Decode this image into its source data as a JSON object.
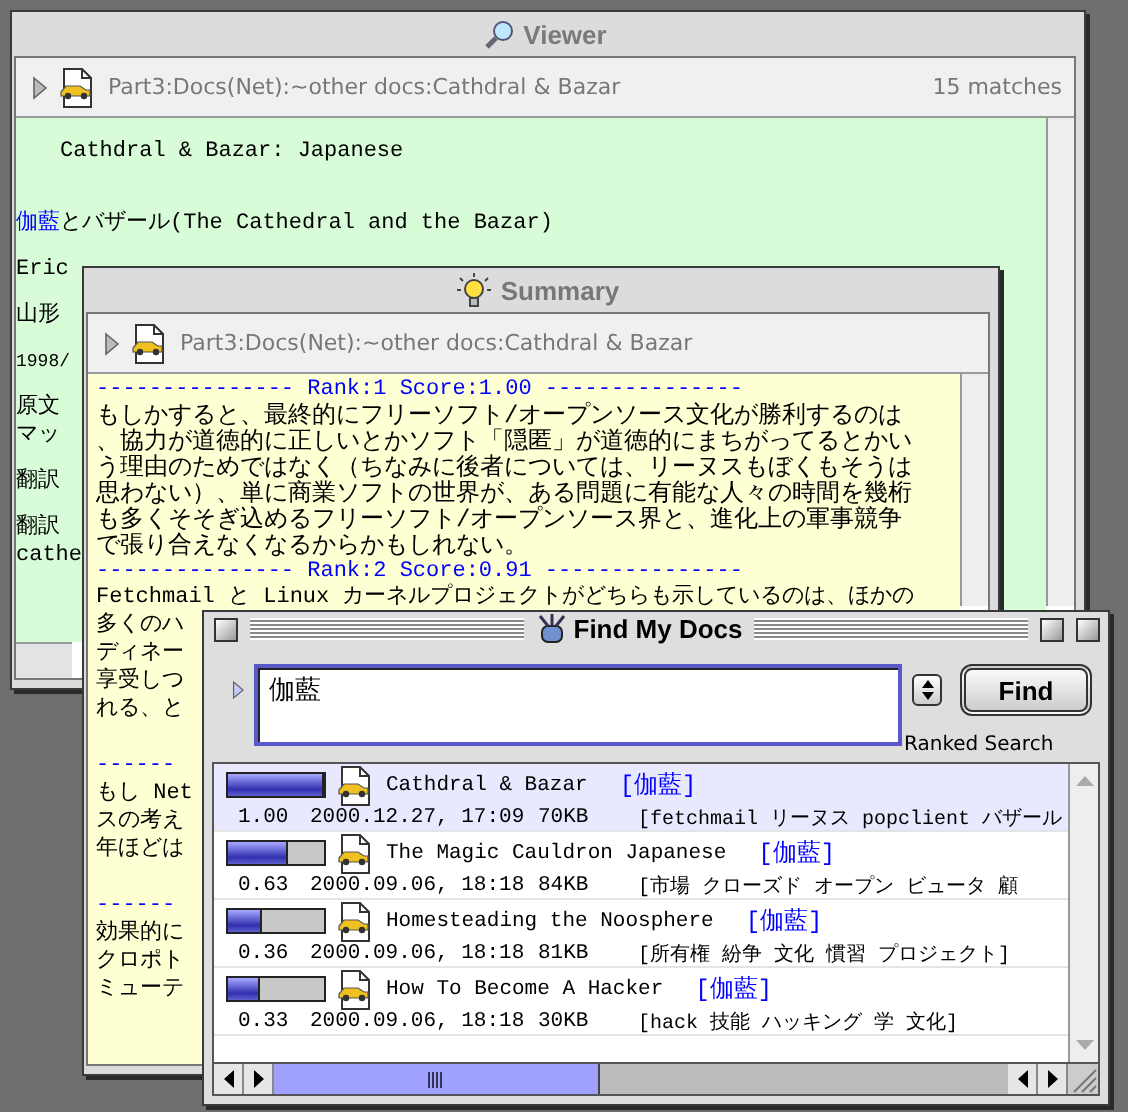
{
  "viewer": {
    "title": "Viewer",
    "path": "Part3:Docs(Net):~other docs:Cathdral & Bazar",
    "matches": "15 matches",
    "blocks": [
      {
        "kind": "heading",
        "text": "Cathdral & Bazar: Japanese"
      },
      {
        "kind": "mixed",
        "segments": [
          {
            "text": "伽藍",
            "hit": true
          },
          {
            "text": "とバザール(The Cathedral and the Bazar)",
            "hit": false
          }
        ]
      },
      {
        "kind": "group",
        "lines": [
          {
            "kind": "text",
            "text": "Eric"
          }
        ]
      },
      {
        "kind": "group",
        "lines": [
          {
            "kind": "text",
            "text": "山形"
          }
        ]
      },
      {
        "kind": "group",
        "lines": [
          {
            "kind": "small",
            "text": "1998/"
          }
        ]
      },
      {
        "kind": "group",
        "lines": [
          {
            "kind": "text",
            "text": "原文"
          },
          {
            "kind": "text",
            "text": "マッ"
          }
        ]
      },
      {
        "kind": "group",
        "lines": [
          {
            "kind": "text",
            "text": "翻訳"
          }
        ]
      },
      {
        "kind": "group",
        "lines": [
          {
            "kind": "text",
            "text": "翻訳"
          },
          {
            "kind": "text",
            "text": "cathe"
          }
        ]
      }
    ]
  },
  "summary": {
    "title": "Summary",
    "path": "Part3:Docs(Net):~other docs:Cathdral & Bazar",
    "ranks": [
      {
        "header": "--------------- Rank:1  Score:1.00 ---------------",
        "text": "もしかすると、最終的にフリーソフト/オープンソース文化が勝利するのは、協力が道徳的に正しいとかソフト「隠匿」が道徳的にまちがってるとかいう理由のためではなく（ちなみに後者については、リーヌスもぼくもそうは思わない）、単に商業ソフトの世界が、ある問題に有能な人々の時間を幾桁も多くそそぎ込めるフリーソフト/オープンソース界と、進化上の軍事競争で張り合えなくなるからかもしれない。"
      },
      {
        "header": "--------------- Rank:2  Score:0.91 ---------------",
        "text": "Fetchmail と Linux カーネルプロジェクトがどちらも示しているのは、ほかの"
      }
    ],
    "cut_groups": [
      {
        "lines": [
          {
            "kind": "text",
            "text": "多くのハ"
          },
          {
            "kind": "text",
            "text": "ディネー"
          },
          {
            "kind": "text",
            "text": "享受しつ"
          },
          {
            "kind": "text",
            "text": "れる、と"
          }
        ]
      },
      {
        "lines": [
          {
            "kind": "rule",
            "text": "------"
          },
          {
            "kind": "text",
            "text": "もし Net"
          },
          {
            "kind": "text",
            "text": "スの考え"
          },
          {
            "kind": "text",
            "text": "年ほどは"
          }
        ]
      },
      {
        "lines": [
          {
            "kind": "rule",
            "text": "------"
          },
          {
            "kind": "text",
            "text": "効果的に"
          },
          {
            "kind": "text",
            "text": "クロポト"
          },
          {
            "kind": "text",
            "text": "ミューテ"
          }
        ]
      }
    ]
  },
  "find": {
    "title": "Find My Docs",
    "query": "伽藍",
    "mode": "Ranked Search",
    "button": "Find",
    "results": [
      {
        "title": "Cathdral & Bazar",
        "tag": "[伽藍]",
        "score": "1.00",
        "date": "2000.12.27, 17:09",
        "size": "70KB",
        "keywords": "[fetchmail リーヌス popclient バザール",
        "level": 1.0,
        "selected": true
      },
      {
        "title": "The Magic Cauldron Japanese",
        "tag": "[伽藍]",
        "score": "0.63",
        "date": "2000.09.06, 18:18",
        "size": "84KB",
        "keywords": "[市場 クローズド オープン ビュータ 顧",
        "level": 0.63,
        "selected": false
      },
      {
        "title": "Homesteading the Noosphere",
        "tag": "[伽藍]",
        "score": "0.36",
        "date": "2000.09.06, 18:18",
        "size": "81KB",
        "keywords": "[所有権 紛争 文化 慣習 プロジェクト]",
        "level": 0.36,
        "selected": false
      },
      {
        "title": "How To Become A Hacker",
        "tag": "[伽藍]",
        "score": "0.33",
        "date": "2000.09.06, 18:18",
        "size": "30KB",
        "keywords": "[hack 技能 ハッキング 学 文化]",
        "level": 0.33,
        "selected": false
      }
    ]
  }
}
